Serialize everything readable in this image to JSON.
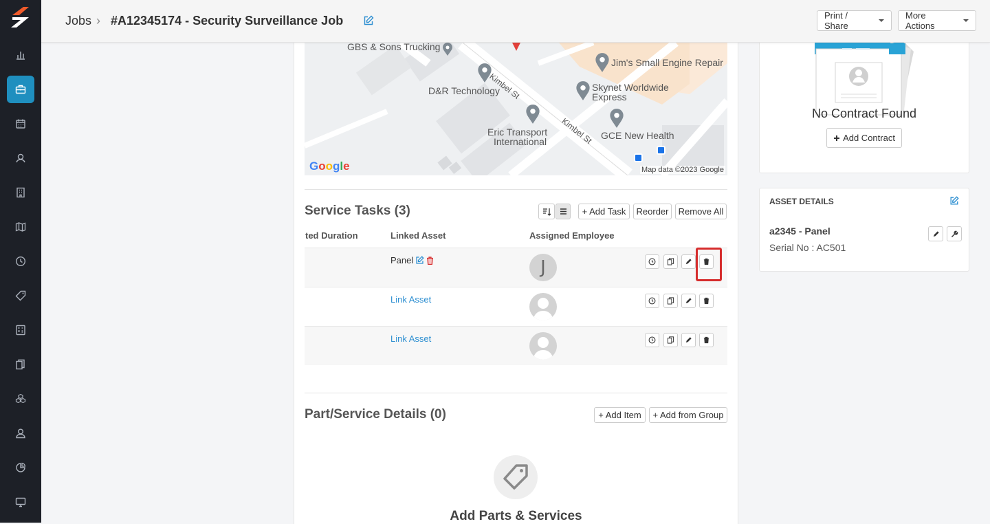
{
  "breadcrumb": {
    "root": "Jobs",
    "separator": "›",
    "title": "#A12345174 - Security Surveillance Job"
  },
  "header_actions": {
    "print_share": "Print / Share",
    "more_actions": "More Actions"
  },
  "sidebar": {
    "items": [
      {
        "icon": "chart-icon"
      },
      {
        "icon": "briefcase-icon",
        "active": true
      },
      {
        "icon": "calendar-icon"
      },
      {
        "icon": "customers-icon"
      },
      {
        "icon": "building-icon"
      },
      {
        "icon": "map-icon"
      },
      {
        "icon": "clock-icon"
      },
      {
        "icon": "tag-icon"
      },
      {
        "icon": "calculator-icon"
      },
      {
        "icon": "documents-icon"
      },
      {
        "icon": "boxes-icon"
      },
      {
        "icon": "user-icon"
      },
      {
        "icon": "pie-chart-icon"
      },
      {
        "icon": "monitor-icon"
      }
    ]
  },
  "map": {
    "labels": [
      "GBS & Sons Trucking",
      "Jim's Small Engine Repair",
      "Skynet Worldwide",
      "Express",
      "D&R Technology",
      "Eric Transport",
      "International",
      "GCE New Health",
      "Kimbel St",
      "Kimbel St"
    ],
    "provider": "Google",
    "attribution": "Map data ©2023 Google"
  },
  "service_tasks": {
    "title": "Service Tasks (3)",
    "buttons": {
      "add_task": "+ Add Task",
      "reorder": "Reorder",
      "remove_all": "Remove All"
    },
    "columns": [
      "ted Duration",
      "Linked Asset",
      "Assigned Employee"
    ],
    "rows": [
      {
        "asset": "Panel",
        "asset_is_link": false,
        "employee_initial": "J"
      },
      {
        "asset": "Link Asset",
        "asset_is_link": true,
        "employee_initial": ""
      },
      {
        "asset": "Link Asset",
        "asset_is_link": true,
        "employee_initial": ""
      }
    ]
  },
  "parts": {
    "title": "Part/Service Details (0)",
    "add_item": "+ Add Item",
    "add_from_group": "+ Add from Group",
    "empty_title": "Add Parts & Services"
  },
  "contract": {
    "empty_text": "No Contract Found",
    "add_label": "Add Contract"
  },
  "asset_details": {
    "heading": "ASSET DETAILS",
    "name": "a2345 - Panel",
    "serial": "Serial No : AC501"
  },
  "colors": {
    "sidebar_bg": "#1d2027",
    "accent": "#1f8fbf",
    "link": "#2e8fd1",
    "danger": "#d62d2d"
  }
}
